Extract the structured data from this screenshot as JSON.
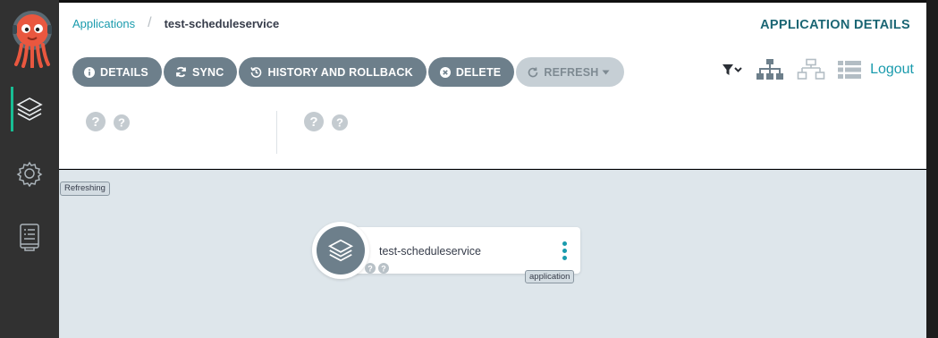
{
  "breadcrumb": {
    "parent": "Applications",
    "current": "test-scheduleservice"
  },
  "page_title": "APPLICATION DETAILS",
  "toolbar": {
    "details": "DETAILS",
    "sync": "SYNC",
    "history": "HISTORY AND ROLLBACK",
    "delete": "DELETE",
    "refresh": "REFRESH"
  },
  "logout": "Logout",
  "canvas": {
    "refresh_badge": "Refreshing",
    "node": {
      "name": "test-scheduleservice",
      "kind": "application"
    }
  },
  "icons": {
    "sidebar": [
      "argo-logo",
      "applications-icon",
      "settings-gear-icon",
      "user-info-icon"
    ],
    "view_modes": [
      "filter-icon",
      "tree-view-icon",
      "network-view-icon",
      "list-view-icon"
    ]
  },
  "colors": {
    "accent": "#1a9bad",
    "button": "#6d7f8b",
    "sidebar": "#313131",
    "title": "#1b6674"
  }
}
